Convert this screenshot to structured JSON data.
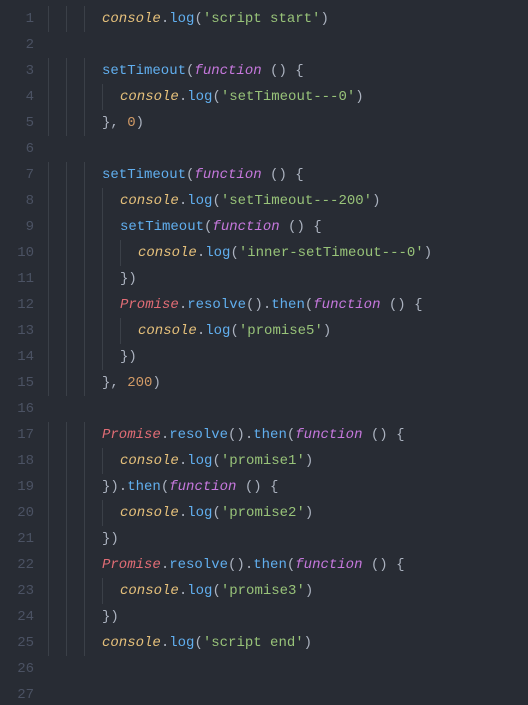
{
  "editor": {
    "language": "javascript",
    "lineCount": 27,
    "indentUnitText": "  ",
    "lines": [
      {
        "n": 1,
        "indent": 3,
        "tokens": [
          [
            "obj",
            "console"
          ],
          [
            "punc",
            "."
          ],
          [
            "fn",
            "log"
          ],
          [
            "punc",
            "("
          ],
          [
            "str",
            "'script start'"
          ],
          [
            "punc",
            ")"
          ]
        ]
      },
      {
        "n": 2,
        "indent": 0,
        "tokens": []
      },
      {
        "n": 3,
        "indent": 3,
        "tokens": [
          [
            "fn",
            "setTimeout"
          ],
          [
            "punc",
            "("
          ],
          [
            "kw",
            "function"
          ],
          [
            "punc",
            " () {"
          ]
        ]
      },
      {
        "n": 4,
        "indent": 4,
        "tokens": [
          [
            "obj",
            "console"
          ],
          [
            "punc",
            "."
          ],
          [
            "fn",
            "log"
          ],
          [
            "punc",
            "("
          ],
          [
            "str",
            "'setTimeout---0'"
          ],
          [
            "punc",
            ")"
          ]
        ]
      },
      {
        "n": 5,
        "indent": 3,
        "tokens": [
          [
            "punc",
            "}, "
          ],
          [
            "num",
            "0"
          ],
          [
            "punc",
            ")"
          ]
        ]
      },
      {
        "n": 6,
        "indent": 0,
        "tokens": []
      },
      {
        "n": 7,
        "indent": 3,
        "tokens": [
          [
            "fn",
            "setTimeout"
          ],
          [
            "punc",
            "("
          ],
          [
            "kw",
            "function"
          ],
          [
            "punc",
            " () {"
          ]
        ]
      },
      {
        "n": 8,
        "indent": 4,
        "tokens": [
          [
            "obj",
            "console"
          ],
          [
            "punc",
            "."
          ],
          [
            "fn",
            "log"
          ],
          [
            "punc",
            "("
          ],
          [
            "str",
            "'setTimeout---200'"
          ],
          [
            "punc",
            ")"
          ]
        ]
      },
      {
        "n": 9,
        "indent": 4,
        "tokens": [
          [
            "fn",
            "setTimeout"
          ],
          [
            "punc",
            "("
          ],
          [
            "kw",
            "function"
          ],
          [
            "punc",
            " () {"
          ]
        ]
      },
      {
        "n": 10,
        "indent": 5,
        "tokens": [
          [
            "obj",
            "console"
          ],
          [
            "punc",
            "."
          ],
          [
            "fn",
            "log"
          ],
          [
            "punc",
            "("
          ],
          [
            "str",
            "'inner-setTimeout---0'"
          ],
          [
            "punc",
            ")"
          ]
        ]
      },
      {
        "n": 11,
        "indent": 4,
        "tokens": [
          [
            "punc",
            "})"
          ]
        ]
      },
      {
        "n": 12,
        "indent": 4,
        "tokens": [
          [
            "id",
            "Promise"
          ],
          [
            "punc",
            "."
          ],
          [
            "fn",
            "resolve"
          ],
          [
            "punc",
            "()."
          ],
          [
            "fn",
            "then"
          ],
          [
            "punc",
            "("
          ],
          [
            "kw",
            "function"
          ],
          [
            "punc",
            " () {"
          ]
        ]
      },
      {
        "n": 13,
        "indent": 5,
        "tokens": [
          [
            "obj",
            "console"
          ],
          [
            "punc",
            "."
          ],
          [
            "fn",
            "log"
          ],
          [
            "punc",
            "("
          ],
          [
            "str",
            "'promise5'"
          ],
          [
            "punc",
            ")"
          ]
        ]
      },
      {
        "n": 14,
        "indent": 4,
        "tokens": [
          [
            "punc",
            "})"
          ]
        ]
      },
      {
        "n": 15,
        "indent": 3,
        "tokens": [
          [
            "punc",
            "}, "
          ],
          [
            "num",
            "200"
          ],
          [
            "punc",
            ")"
          ]
        ]
      },
      {
        "n": 16,
        "indent": 0,
        "tokens": []
      },
      {
        "n": 17,
        "indent": 3,
        "tokens": [
          [
            "id",
            "Promise"
          ],
          [
            "punc",
            "."
          ],
          [
            "fn",
            "resolve"
          ],
          [
            "punc",
            "()."
          ],
          [
            "fn",
            "then"
          ],
          [
            "punc",
            "("
          ],
          [
            "kw",
            "function"
          ],
          [
            "punc",
            " () {"
          ]
        ]
      },
      {
        "n": 18,
        "indent": 4,
        "tokens": [
          [
            "obj",
            "console"
          ],
          [
            "punc",
            "."
          ],
          [
            "fn",
            "log"
          ],
          [
            "punc",
            "("
          ],
          [
            "str",
            "'promise1'"
          ],
          [
            "punc",
            ")"
          ]
        ]
      },
      {
        "n": 19,
        "indent": 3,
        "tokens": [
          [
            "punc",
            "})."
          ],
          [
            "fn",
            "then"
          ],
          [
            "punc",
            "("
          ],
          [
            "kw",
            "function"
          ],
          [
            "punc",
            " () {"
          ]
        ]
      },
      {
        "n": 20,
        "indent": 4,
        "tokens": [
          [
            "obj",
            "console"
          ],
          [
            "punc",
            "."
          ],
          [
            "fn",
            "log"
          ],
          [
            "punc",
            "("
          ],
          [
            "str",
            "'promise2'"
          ],
          [
            "punc",
            ")"
          ]
        ]
      },
      {
        "n": 21,
        "indent": 3,
        "tokens": [
          [
            "punc",
            "})"
          ]
        ]
      },
      {
        "n": 22,
        "indent": 3,
        "tokens": [
          [
            "id",
            "Promise"
          ],
          [
            "punc",
            "."
          ],
          [
            "fn",
            "resolve"
          ],
          [
            "punc",
            "()."
          ],
          [
            "fn",
            "then"
          ],
          [
            "punc",
            "("
          ],
          [
            "kw",
            "function"
          ],
          [
            "punc",
            " () {"
          ]
        ]
      },
      {
        "n": 23,
        "indent": 4,
        "tokens": [
          [
            "obj",
            "console"
          ],
          [
            "punc",
            "."
          ],
          [
            "fn",
            "log"
          ],
          [
            "punc",
            "("
          ],
          [
            "str",
            "'promise3'"
          ],
          [
            "punc",
            ")"
          ]
        ]
      },
      {
        "n": 24,
        "indent": 3,
        "tokens": [
          [
            "punc",
            "})"
          ]
        ]
      },
      {
        "n": 25,
        "indent": 3,
        "tokens": [
          [
            "obj",
            "console"
          ],
          [
            "punc",
            "."
          ],
          [
            "fn",
            "log"
          ],
          [
            "punc",
            "("
          ],
          [
            "str",
            "'script end'"
          ],
          [
            "punc",
            ")"
          ]
        ]
      },
      {
        "n": 26,
        "indent": 0,
        "tokens": []
      },
      {
        "n": 27,
        "indent": 0,
        "tokens": []
      }
    ]
  }
}
